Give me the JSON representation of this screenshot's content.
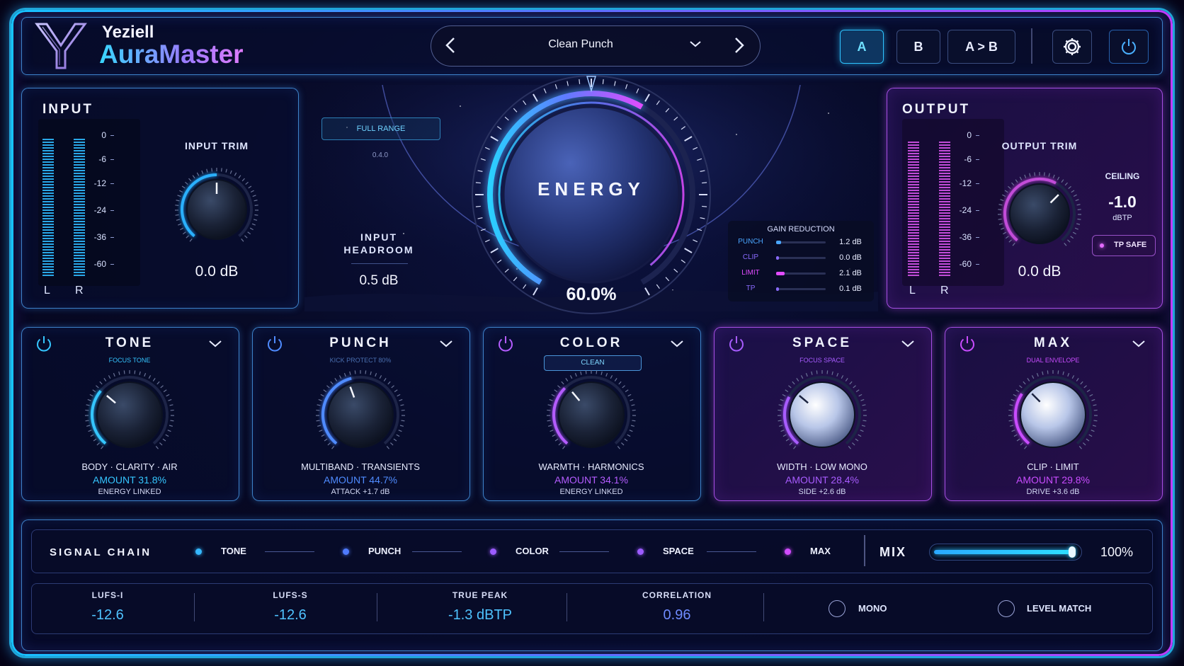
{
  "brand": {
    "company": "Yeziell",
    "product": "AuraMaster",
    "logo_letter": "Y"
  },
  "preset": {
    "name": "Clean Punch",
    "prev_icon": "chevron-left-icon",
    "next_icon": "chevron-right-icon",
    "dropdown_icon": "chevron-down-icon"
  },
  "ab": {
    "a": "A",
    "b": "B",
    "copy": "A > B"
  },
  "header_icons": {
    "settings": "gear-icon",
    "power": "power-icon"
  },
  "input": {
    "title": "INPUT",
    "scale": [
      "0",
      "-6",
      "-12",
      "-24",
      "-36",
      "-60"
    ],
    "left_label": "L",
    "right_label": "R",
    "trim_label": "INPUT TRIM",
    "trim_value": "0.0 dB"
  },
  "center": {
    "full_range": "FULL RANGE",
    "version": "0.4.0",
    "headroom_label": "INPUT HEADROOM",
    "headroom_value": "0.5 dB",
    "energy_label": "ENERGY",
    "energy_value": "60.0%",
    "energy_fraction": 0.6
  },
  "gain_reduction": {
    "title": "GAIN REDUCTION",
    "rows": [
      {
        "label": "PUNCH",
        "value": "1.2 dB",
        "fraction": 0.1,
        "color": "#4aa6ff"
      },
      {
        "label": "CLIP",
        "value": "0.0 dB",
        "fraction": 0.0,
        "color": "#8a6bff"
      },
      {
        "label": "LIMIT",
        "value": "2.1 dB",
        "fraction": 0.17,
        "color": "#e24cff"
      },
      {
        "label": "TP",
        "value": "0.1 dB",
        "fraction": 0.02,
        "color": "#8a6bff"
      }
    ]
  },
  "output": {
    "title": "OUTPUT",
    "scale": [
      "0",
      "-6",
      "-12",
      "-24",
      "-36",
      "-60"
    ],
    "left_label": "L",
    "right_label": "R",
    "trim_label": "OUTPUT TRIM",
    "trim_value": "0.0 dB",
    "ceiling_label": "CEILING",
    "ceiling_value": "-1.0",
    "ceiling_unit": "dBTP",
    "tp_safe": "TP SAFE"
  },
  "modules": [
    {
      "title": "TONE",
      "mode": "FOCUS TONE",
      "desc": "BODY · CLARITY · AIR",
      "amount": "AMOUNT 31.8%",
      "sub": "ENERGY LINKED",
      "accent": "#35c6ff"
    },
    {
      "title": "PUNCH",
      "mode": "KICK PROTECT 80%",
      "desc": "MULTIBAND · TRANSIENTS",
      "amount": "AMOUNT 44.7%",
      "sub": "ATTACK +1.7 dB",
      "accent": "#4f8bff"
    },
    {
      "title": "COLOR",
      "mode": "CLEAN",
      "desc": "WARMTH · HARMONICS",
      "amount": "AMOUNT 34.1%",
      "sub": "ENERGY LINKED",
      "accent": "#b45cff"
    },
    {
      "title": "SPACE",
      "mode": "FOCUS SPACE",
      "desc": "WIDTH · LOW MONO",
      "amount": "AMOUNT 28.4%",
      "sub": "SIDE +2.6 dB",
      "accent": "#a85cff"
    },
    {
      "title": "MAX",
      "mode": "DUAL ENVELOPE",
      "desc": "CLIP · LIMIT",
      "amount": "AMOUNT 29.8%",
      "sub": "DRIVE +3.6 dB",
      "accent": "#c94cff"
    }
  ],
  "signal_chain": {
    "title": "SIGNAL CHAIN",
    "items": [
      {
        "label": "TONE",
        "color": "#35b8ff"
      },
      {
        "label": "PUNCH",
        "color": "#4f7bff"
      },
      {
        "label": "COLOR",
        "color": "#9c5cff"
      },
      {
        "label": "SPACE",
        "color": "#9c5cff"
      },
      {
        "label": "MAX",
        "color": "#d04cff"
      }
    ],
    "mix_label": "MIX",
    "mix_value": "100%",
    "mix_fraction": 1.0
  },
  "meters": [
    {
      "label": "LUFS-I",
      "value": "-12.6"
    },
    {
      "label": "LUFS-S",
      "value": "-12.6"
    },
    {
      "label": "TRUE PEAK",
      "value": "-1.3 dBTP"
    },
    {
      "label": "CORRELATION",
      "value": "0.96"
    }
  ],
  "toggles": {
    "mono": "MONO",
    "level_match": "LEVEL MATCH"
  }
}
